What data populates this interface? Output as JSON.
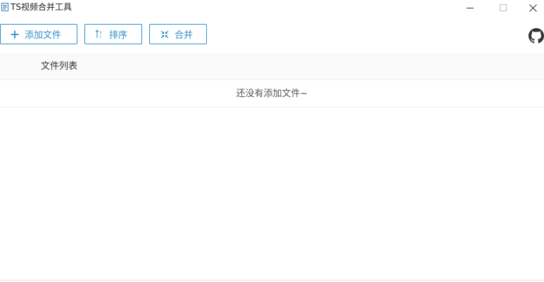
{
  "window": {
    "title": "TS视频合并工具",
    "app_icon": "video-app-icon",
    "controls": {
      "minimize_icon": "minimize-icon",
      "maximize_icon": "maximize-icon",
      "close_icon": "close-icon"
    }
  },
  "toolbar": {
    "add_label": "添加文件",
    "add_icon": "plus-icon",
    "sort_label": "排序",
    "sort_icon": "sort-az-icon",
    "merge_label": "合并",
    "merge_icon": "merge-arrows-icon",
    "accent_color": "#2f8fc7"
  },
  "github": {
    "icon": "github-icon"
  },
  "table": {
    "columns": [
      "文件列表"
    ],
    "empty_text": "还没有添加文件~"
  }
}
